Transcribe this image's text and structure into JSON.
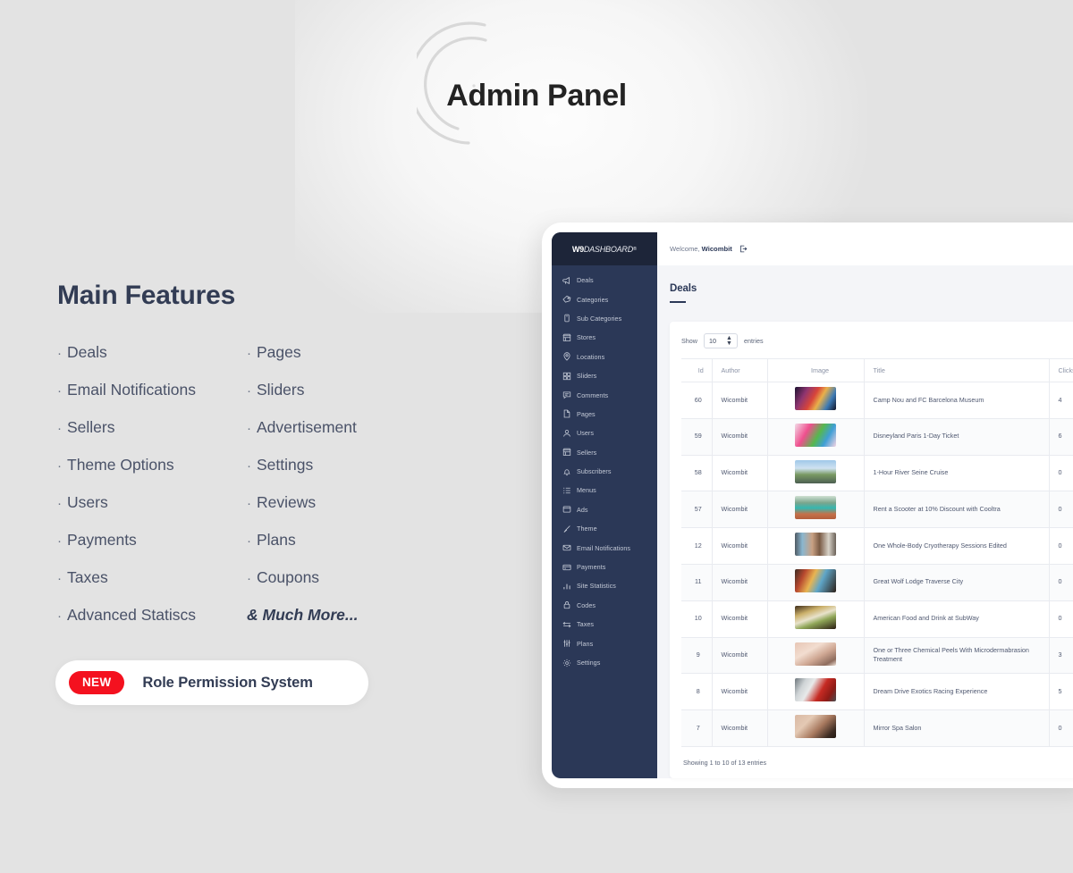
{
  "hero": {
    "title": "Admin Panel"
  },
  "features": {
    "heading": "Main Features",
    "bullet": "·",
    "column_left": [
      "Deals",
      "Email Notifications",
      "Sellers",
      "Theme Options",
      "Users",
      "Payments",
      "Taxes",
      "Advanced Statiscs"
    ],
    "column_right": [
      "Pages",
      "Sliders",
      "Advertisement",
      "Settings",
      "Reviews",
      "Plans",
      "Coupons"
    ],
    "more_label": "& Much More..."
  },
  "new_pill": {
    "badge": "NEW",
    "label": "Role Permission System",
    "badge_color": "#f4111f"
  },
  "dashboard": {
    "brand": {
      "mark": "W9",
      "name": "DASHBOARD",
      "registered": "®"
    },
    "topbar": {
      "welcome": "Welcome,",
      "user": "Wicombit",
      "logout_icon": "logout-icon"
    },
    "page": {
      "title": "Deals"
    },
    "sidebar": {
      "items": [
        {
          "label": "Deals",
          "icon": "megaphone-icon"
        },
        {
          "label": "Categories",
          "icon": "tag-icon"
        },
        {
          "label": "Sub Categories",
          "icon": "bookmark-icon"
        },
        {
          "label": "Stores",
          "icon": "store-icon"
        },
        {
          "label": "Locations",
          "icon": "map-pin-icon"
        },
        {
          "label": "Sliders",
          "icon": "grid-icon"
        },
        {
          "label": "Comments",
          "icon": "comment-icon"
        },
        {
          "label": "Pages",
          "icon": "page-icon"
        },
        {
          "label": "Users",
          "icon": "user-icon"
        },
        {
          "label": "Sellers",
          "icon": "store-icon"
        },
        {
          "label": "Subscribers",
          "icon": "bell-icon"
        },
        {
          "label": "Menus",
          "icon": "list-icon"
        },
        {
          "label": "Ads",
          "icon": "window-icon"
        },
        {
          "label": "Theme",
          "icon": "brush-icon"
        },
        {
          "label": "Email Notifications",
          "icon": "envelope-icon"
        },
        {
          "label": "Payments",
          "icon": "credit-card-icon"
        },
        {
          "label": "Site Statistics",
          "icon": "bar-chart-icon"
        },
        {
          "label": "Codes",
          "icon": "lock-icon"
        },
        {
          "label": "Taxes",
          "icon": "exchange-icon"
        },
        {
          "label": "Plans",
          "icon": "sliders-icon"
        },
        {
          "label": "Settings",
          "icon": "gear-icon"
        }
      ]
    },
    "table": {
      "show_label": "Show",
      "entries_value": "10",
      "entries_label": "entries",
      "columns": [
        "Id",
        "Author",
        "Image",
        "Title",
        "Clicks"
      ],
      "rows": [
        {
          "id": "60",
          "author": "Wicombit",
          "title": "Camp Nou and FC Barcelona Museum",
          "clicks": "4"
        },
        {
          "id": "59",
          "author": "Wicombit",
          "title": "Disneyland Paris 1-Day Ticket",
          "clicks": "6"
        },
        {
          "id": "58",
          "author": "Wicombit",
          "title": "1-Hour River Seine Cruise",
          "clicks": "0"
        },
        {
          "id": "57",
          "author": "Wicombit",
          "title": "Rent a Scooter at 10% Discount with Cooltra",
          "clicks": "0"
        },
        {
          "id": "12",
          "author": "Wicombit",
          "title": "One Whole-Body Cryotherapy Sessions Edited",
          "clicks": "0"
        },
        {
          "id": "11",
          "author": "Wicombit",
          "title": "Great Wolf Lodge Traverse City",
          "clicks": "0"
        },
        {
          "id": "10",
          "author": "Wicombit",
          "title": "American Food and Drink at SubWay",
          "clicks": "0"
        },
        {
          "id": "9",
          "author": "Wicombit",
          "title": "One or Three Chemical Peels With Microdermabrasion Treatment",
          "clicks": "3"
        },
        {
          "id": "8",
          "author": "Wicombit",
          "title": "Dream Drive Exotics Racing Experience",
          "clicks": "5"
        },
        {
          "id": "7",
          "author": "Wicombit",
          "title": "Mirror Spa Salon",
          "clicks": "0"
        }
      ],
      "footer": "Showing 1 to 10 of 13 entries"
    }
  },
  "colors": {
    "page_bg": "#e3e3e3",
    "sidebar_bg": "#2b3857",
    "brand_bg": "#1d2539",
    "accent_navy": "#323c54",
    "panel_bg": "#f4f5f8"
  }
}
